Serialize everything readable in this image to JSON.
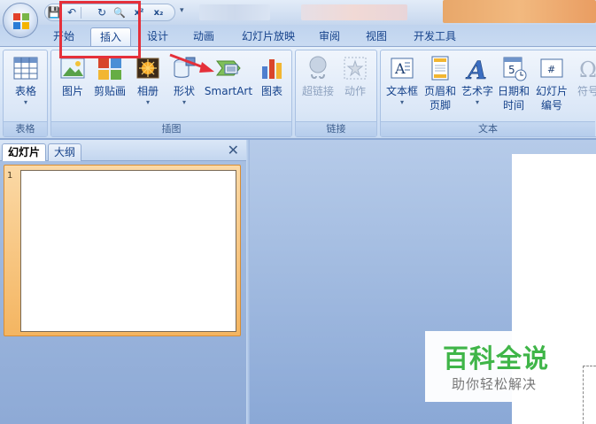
{
  "qat": {
    "items": [
      {
        "name": "save-icon",
        "glyph": "💾"
      },
      {
        "name": "undo-icon",
        "glyph": "↶"
      },
      {
        "name": "redo-icon",
        "glyph": "↻"
      },
      {
        "name": "print-preview-icon",
        "glyph": "🔍"
      },
      {
        "name": "superscript-icon",
        "glyph": "x²"
      },
      {
        "name": "subscript-icon",
        "glyph": "x₂"
      }
    ],
    "more_glyph": "▾"
  },
  "tabs": [
    {
      "label": "开始",
      "active": false
    },
    {
      "label": "插入",
      "active": true
    },
    {
      "label": "设计",
      "active": false
    },
    {
      "label": "动画",
      "active": false
    },
    {
      "label": "幻灯片放映",
      "active": false
    },
    {
      "label": "审阅",
      "active": false
    },
    {
      "label": "视图",
      "active": false
    },
    {
      "label": "开发工具",
      "active": false
    }
  ],
  "ribbon": {
    "groups": {
      "table": {
        "label": "表格",
        "buttons": [
          {
            "label": "表格",
            "dropdown": true
          }
        ]
      },
      "illustrations": {
        "label": "插图",
        "buttons": [
          {
            "label": "图片"
          },
          {
            "label": "剪贴画"
          },
          {
            "label": "相册",
            "dropdown": true
          },
          {
            "label": "形状",
            "dropdown": true
          },
          {
            "label": "SmartArt"
          },
          {
            "label": "图表"
          }
        ]
      },
      "links": {
        "label": "链接",
        "buttons": [
          {
            "label": "超链接",
            "disabled": true
          },
          {
            "label": "动作",
            "disabled": true
          }
        ]
      },
      "text": {
        "label": "文本",
        "buttons": [
          {
            "label": "文本框",
            "dropdown": true
          },
          {
            "label": "页眉和",
            "label2": "页脚"
          },
          {
            "label": "艺术字",
            "dropdown": true
          },
          {
            "label": "日期和",
            "label2": "时间"
          },
          {
            "label": "幻灯片",
            "label2": "编号"
          },
          {
            "label": "符号"
          }
        ]
      }
    }
  },
  "left_pane": {
    "tabs": [
      "幻灯片",
      "大纲"
    ],
    "close_glyph": "✕",
    "slides": [
      {
        "number": "1"
      }
    ]
  },
  "watermark": {
    "title": "百科全说",
    "subtitle": "助你轻松解决"
  },
  "colors": {
    "annotation": "#e5303a",
    "accent": "#15428b",
    "watermark": "#3fb548"
  }
}
